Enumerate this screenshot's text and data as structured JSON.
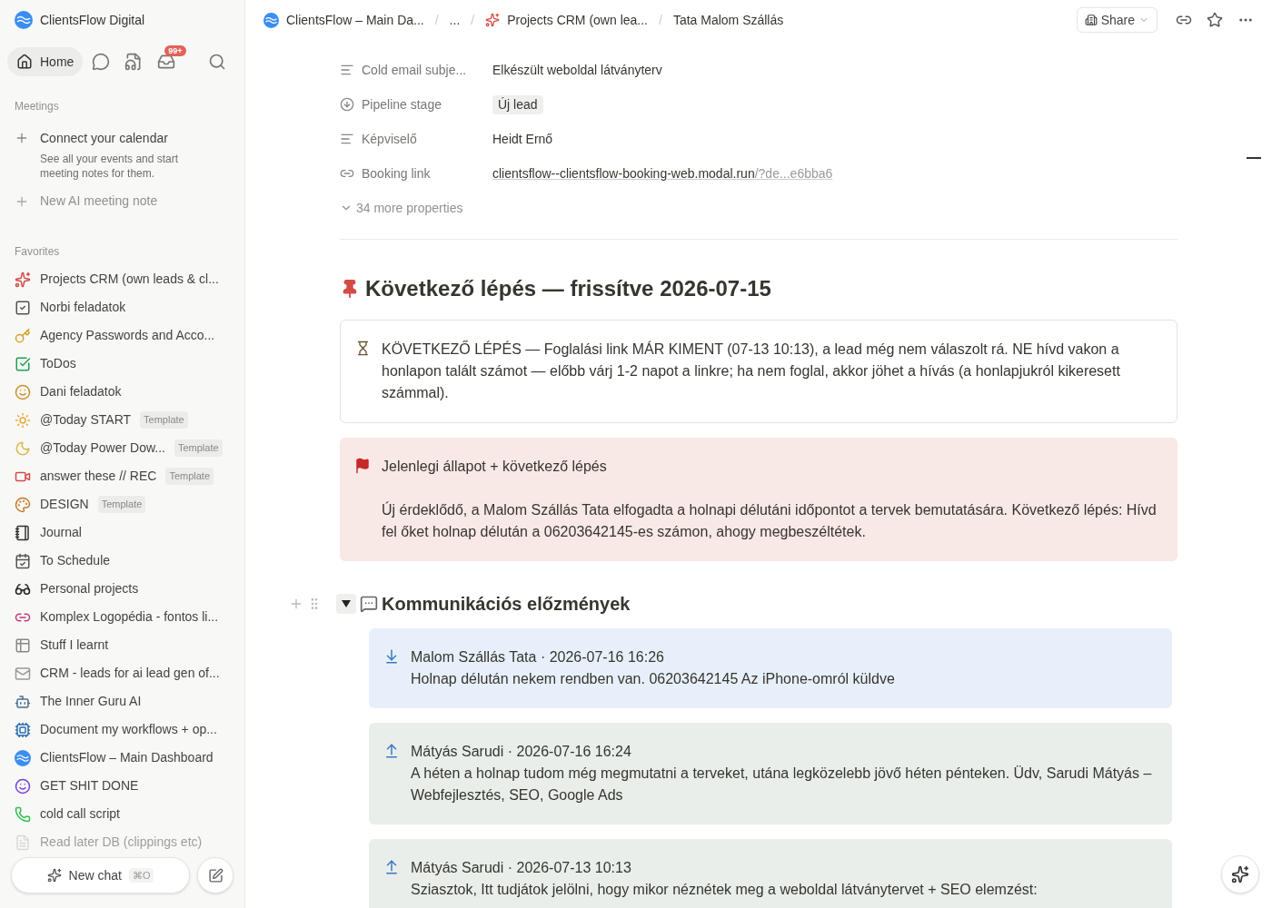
{
  "workspace": {
    "name": "ClientsFlow Digital"
  },
  "nav": {
    "home": {
      "label": "Home",
      "selected": true
    },
    "inbox_badge": "99+"
  },
  "meetings": {
    "title": "Meetings",
    "connect": {
      "label": "Connect your calendar",
      "description": "See all your events and start meeting notes for them."
    },
    "new_note": "New AI meeting note"
  },
  "favorites": {
    "title": "Favorites",
    "items": [
      {
        "label": "Projects CRM (own leads & cl..."
      },
      {
        "label": "Norbi feladatok"
      },
      {
        "label": "Agency Passwords and Acco..."
      },
      {
        "label": "ToDos"
      },
      {
        "label": "Dani feladatok"
      },
      {
        "label": "@Today START",
        "badge": "Template"
      },
      {
        "label": "@Today Power Dow...",
        "badge": "Template"
      },
      {
        "label": "answer these // REC",
        "badge": "Template"
      },
      {
        "label": "DESIGN",
        "badge": "Template"
      },
      {
        "label": "Journal"
      },
      {
        "label": "To Schedule"
      },
      {
        "label": "Personal projects"
      },
      {
        "label": "Komplex Logopédia - fontos li..."
      },
      {
        "label": "Stuff I learnt"
      },
      {
        "label": "CRM - leads for ai lead gen of..."
      },
      {
        "label": "The Inner Guru AI"
      },
      {
        "label": "Document my workflows + op..."
      },
      {
        "label": "ClientsFlow – Main Dashboard"
      },
      {
        "label": "GET SHIT DONE"
      },
      {
        "label": "cold call script"
      },
      {
        "label": "Read later DB (clippings etc)"
      }
    ]
  },
  "new_chat": {
    "label": "New chat",
    "shortcut": "⌘O"
  },
  "breadcrumb_separator": "/",
  "breadcrumbs": [
    "ClientsFlow – Main Da...",
    "...",
    "Projects CRM (own lea...",
    "Tata Malom Szállás"
  ],
  "share": "Share",
  "properties": [
    {
      "kind": "text",
      "name": "Cold email subje...",
      "value": "Elkészült weboldal látványterv"
    },
    {
      "kind": "status",
      "name": "Pipeline stage",
      "value": "Új lead"
    },
    {
      "kind": "text",
      "name": "Képviselő",
      "value": "Heidt Ernő"
    },
    {
      "kind": "link",
      "name": "Booking link",
      "value": "clientsflow--clientsflow-booking-web.modal.run",
      "value_tail": "/?de...e6bba6"
    }
  ],
  "more_properties": "34 more properties",
  "next_step": {
    "heading": "Következő lépés — frissítve 2026-07-15",
    "callout": "KÖVETKEZŐ LÉPÉS — Foglalási link MÁR KIMENT (07-13 10:13), a lead még nem válaszolt rá. NE hívd vakon a honlapon talált számot — előbb várj 1-2 napot a linkre; ha nem foglal, akkor jöhet a hívás (a honlapjukról kikeresett számmal).",
    "status_title": "Jelenlegi állapot + következő lépés",
    "status_text": "Új érdeklődő, a Malom Szállás Tata elfogadta a holnapi délutáni időpontot a tervek bemutatására. Következő lépés: Hívd fel őket holnap délután a 06203642145-es számon, ahogy megbeszéltétek."
  },
  "history": {
    "heading": "Kommunikációs előzmények",
    "expanded": true,
    "messages": [
      {
        "kind": "received",
        "header": "Malom Szállás Tata · 2026-07-16 16:26",
        "body": "Holnap délután nekem rendben van. 06203642145 Az iPhone-omról küldve"
      },
      {
        "kind": "sent",
        "header": "Mátyás Sarudi · 2026-07-16 16:24",
        "body": "A héten a holnap tudom még megmutatni a terveket, utána legközelebb jövő héten pénteken. Üdv, Sarudi Mátyás – Webfejlesztés, SEO, Google Ads"
      },
      {
        "kind": "sent",
        "header": "Mátyás Sarudi · 2026-07-13 10:13",
        "body": "Sziasztok, Itt tudjátok jelölni, hogy mikor néznétek meg a weboldal látványtervet + SEO elemzést:"
      }
    ]
  }
}
